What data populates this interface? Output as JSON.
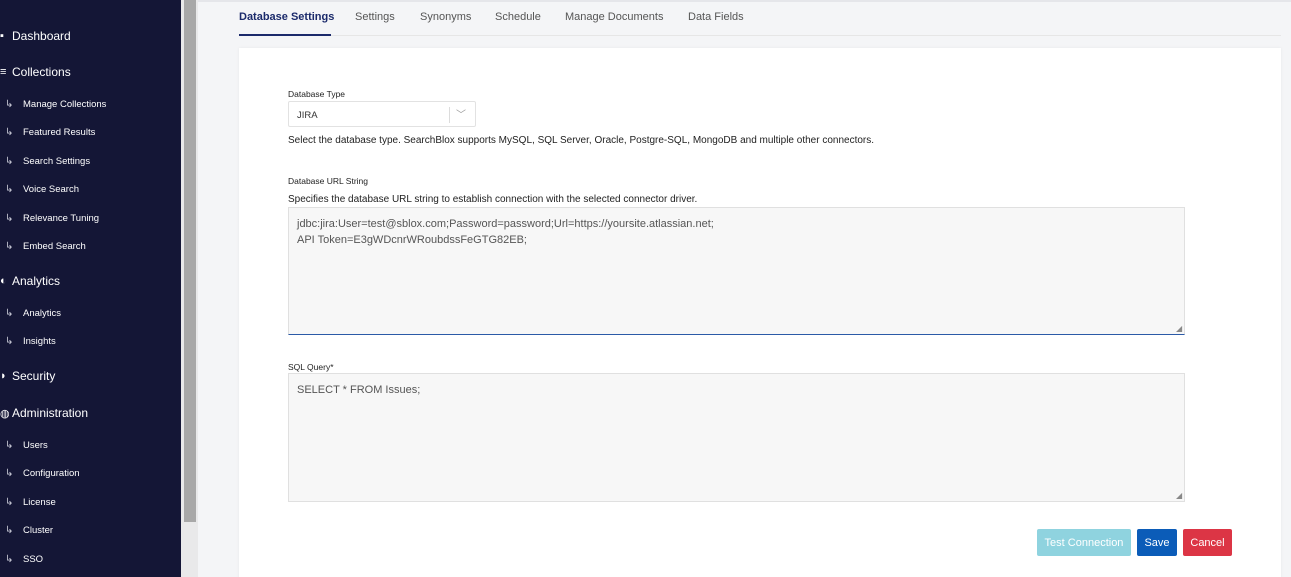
{
  "sidebar": {
    "sections": [
      {
        "label": "Dashboard",
        "icon": "dashboard-icon"
      },
      {
        "label": "Collections",
        "icon": "collections-icon"
      },
      {
        "label": "Analytics",
        "icon": "analytics-icon"
      },
      {
        "label": "Security",
        "icon": "security-icon"
      },
      {
        "label": "Administration",
        "icon": "administration-icon"
      }
    ],
    "collections_items": [
      "Manage Collections",
      "Featured Results",
      "Search Settings",
      "Voice Search",
      "Relevance Tuning",
      "Embed Search"
    ],
    "analytics_items": [
      "Analytics",
      "Insights"
    ],
    "administration_items": [
      "Users",
      "Configuration",
      "License",
      "Cluster",
      "SSO"
    ],
    "sub_arrow": "↳"
  },
  "tabs": [
    "Database Settings",
    "Settings",
    "Synonyms",
    "Schedule",
    "Manage Documents",
    "Data Fields"
  ],
  "form": {
    "db_type_label": "Database Type",
    "db_type_value": "JIRA",
    "db_type_help": "Select the database type. SearchBlox supports MySQL, SQL Server, Oracle, Postgre-SQL, MongoDB and multiple other connectors.",
    "url_label": "Database URL String",
    "url_help": "Specifies the database URL string to establish connection with the selected connector driver.",
    "url_value": "jdbc:jira:User=test@sblox.com;Password=password;Url=https://yoursite.atlassian.net;\nAPI Token=E3gWDcnrWRoubdssFeGTG82EB;",
    "sql_label": "SQL Query*",
    "sql_value": "SELECT * FROM Issues;"
  },
  "buttons": {
    "test": "Test Connection",
    "save": "Save",
    "cancel": "Cancel"
  },
  "colors": {
    "sidebar_bg": "#141636",
    "active_tab": "#1b2a6b",
    "save": "#0b5cb8",
    "cancel": "#dc3545",
    "test": "#8fd3df"
  }
}
